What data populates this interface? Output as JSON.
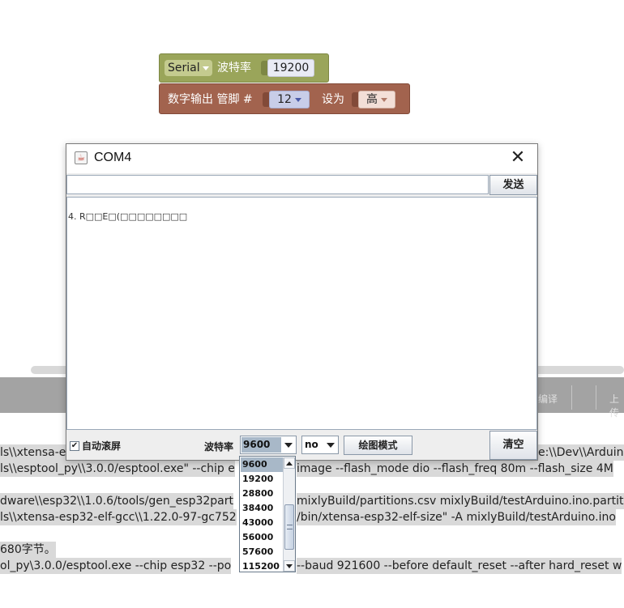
{
  "blocks": {
    "serial": {
      "port": "Serial",
      "label": "波特率",
      "baud": "19200"
    },
    "digital_write": {
      "label": "数字输出 管脚 #",
      "pin": "12",
      "set_label": "设为",
      "level": "高"
    }
  },
  "ide": {
    "toolbar": {
      "compile": "编译",
      "upload": "上传"
    },
    "console_lines": [
      "ls\\\\xtensa-e",
      "ls\\\\esptool_py\\\\3.0.0/esptool.exe\" --chip e",
      "dware\\\\esp32\\\\1.0.6/tools/gen_esp32part",
      "ls\\\\xtensa-esp32-elf-gcc\\\\1.22.0-97-gc752",
      "680字节。",
      "ol_py\\3.0.0/esptool.exe --chip esp32 --po"
    ],
    "console_right": [
      "e:\\\\Dev\\\\Arduin",
      "image --flash_mode dio --flash_freq 80m --flash_size 4M",
      "mixlyBuild/partitions.csv mixlyBuild/testArduino.ino.partiti",
      "/bin/xtensa-esp32-elf-size\" -A mixlyBuild/testArduino.ino",
      "--baud 921600 --before default_reset --after hard_reset w"
    ]
  },
  "serial_monitor": {
    "title": "COM4",
    "send_input": "",
    "send_label": "发送",
    "output_text": "4. R□□E□(□□□□□□□□",
    "autoscroll_label": "自动滚屏",
    "autoscroll_checked": "✔",
    "baud_label": "波特率",
    "baud_selected": "9600",
    "parity_selected": "no",
    "plot_label": "绘图模式",
    "clear_label": "清空",
    "baud_options": [
      "9600",
      "19200",
      "28800",
      "38400",
      "43000",
      "56000",
      "57600",
      "115200"
    ]
  }
}
